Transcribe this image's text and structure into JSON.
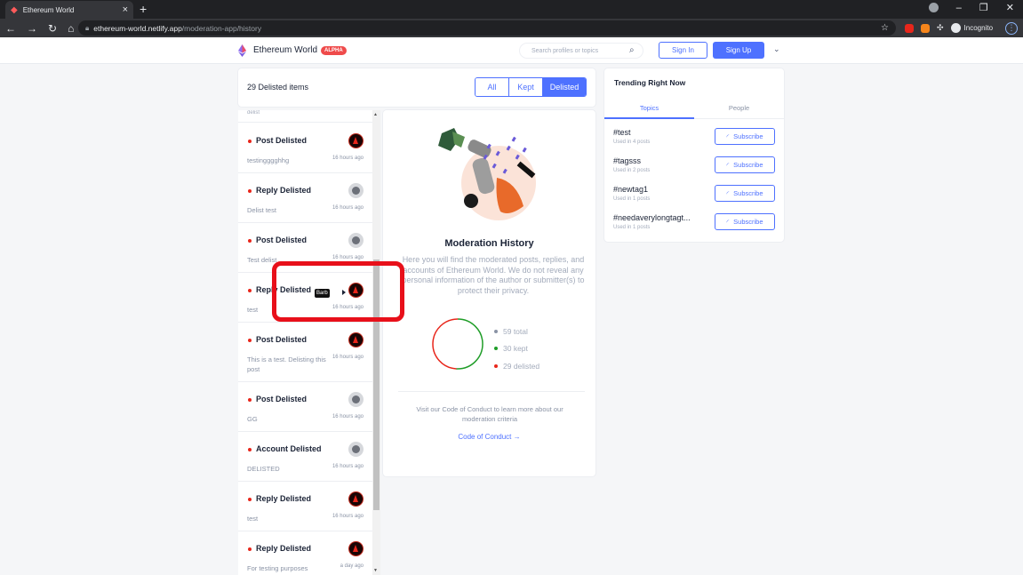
{
  "browser": {
    "tab_title": "Ethereum World",
    "url_host": "ethereum-world.netlify.app",
    "url_path": "/moderation-app/history",
    "profile_label": "Incognito"
  },
  "header": {
    "brand": "Ethereum World",
    "badge": "ALPHA",
    "search_placeholder": "Search profiles or topics",
    "sign_in": "Sign In",
    "sign_up": "Sign Up"
  },
  "summary": {
    "count_label": "29 Delisted items",
    "filters": [
      "All",
      "Kept",
      "Delisted"
    ],
    "active_filter": "Delisted"
  },
  "list": {
    "partial_top": "delist",
    "items": [
      {
        "title": "Post Delisted",
        "sub": "testingggghhg",
        "time": "16 hours ago",
        "avatar": "dark"
      },
      {
        "title": "Reply Delisted",
        "sub": "Delist test",
        "time": "16 hours ago",
        "avatar": "grey"
      },
      {
        "title": "Post Delisted",
        "sub": "Test delist",
        "time": "16 hours ago",
        "avatar": "grey"
      },
      {
        "title": "Reply Delisted",
        "sub": "test",
        "time": "16 hours ago",
        "avatar": "dark",
        "tooltip": "Barb"
      },
      {
        "title": "Post Delisted",
        "sub": "This is a test. Delisting this post",
        "time": "16 hours ago",
        "avatar": "dark"
      },
      {
        "title": "Post Delisted",
        "sub": "GG",
        "time": "16 hours ago",
        "avatar": "grey"
      },
      {
        "title": "Account Delisted",
        "sub": "DELISTED",
        "time": "16 hours ago",
        "avatar": "grey"
      },
      {
        "title": "Reply Delisted",
        "sub": "test",
        "time": "16 hours ago",
        "avatar": "dark"
      },
      {
        "title": "Reply Delisted",
        "sub": "For testing purposes",
        "time": "a day ago",
        "avatar": "dark"
      }
    ]
  },
  "history": {
    "title": "Moderation History",
    "description": "Here you will find the moderated posts, replies, and accounts of Ethereum World. We do not reveal any personal information of the author or submitter(s) to protect their privacy.",
    "stats": {
      "total_label": "59 total",
      "kept_label": "30 kept",
      "delisted_label": "29 delisted",
      "kept": 30,
      "delisted": 29
    },
    "colors": {
      "total": "#8a93a5",
      "kept": "#1f9d28",
      "delisted": "#e8261b"
    },
    "coc_text": "Visit our Code of Conduct to learn more about our moderation criteria",
    "coc_link": "Code of Conduct →"
  },
  "trending": {
    "title": "Trending Right Now",
    "tabs": [
      "Topics",
      "People"
    ],
    "subscribe_label": "Subscribe",
    "topics": [
      {
        "tag": "#test",
        "used": "Used in 4 posts"
      },
      {
        "tag": "#tagsss",
        "used": "Used in 2 posts"
      },
      {
        "tag": "#newtag1",
        "used": "Used in 1 posts"
      },
      {
        "tag": "#needaverylongtagt...",
        "used": "Used in 1 posts"
      }
    ]
  },
  "theme": {
    "accent": "#4e71ff",
    "alert": "#e8101a"
  }
}
